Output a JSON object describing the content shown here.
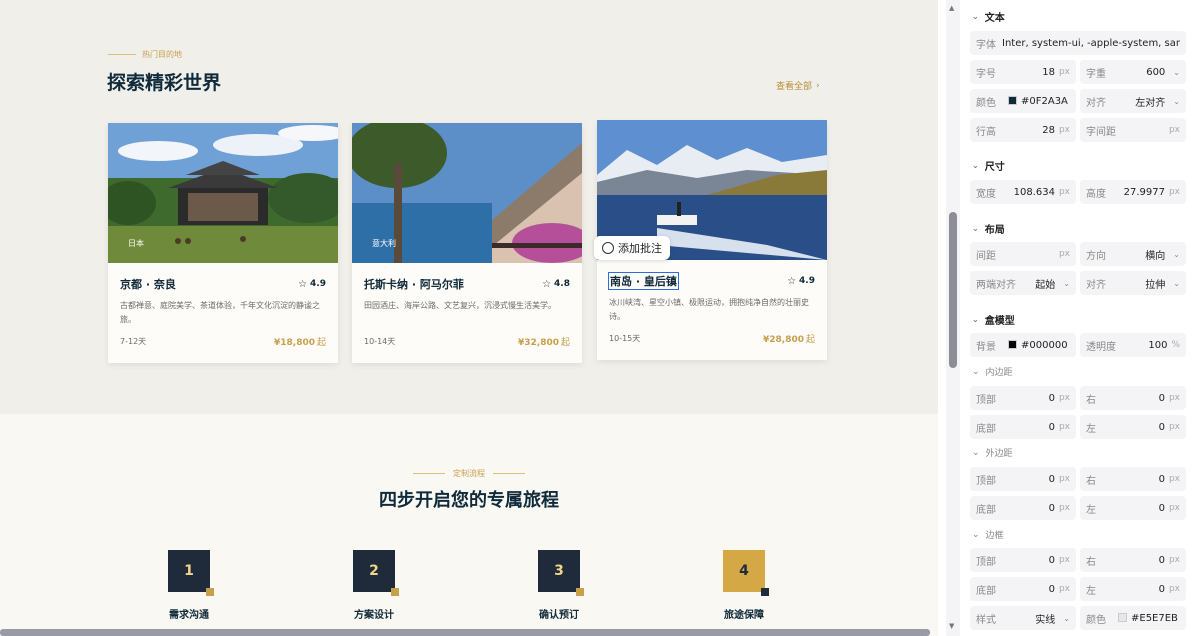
{
  "explore": {
    "eyebrow": "热门目的地",
    "heading": "探索精彩世界",
    "view_all": "查看全部",
    "view_all_arrow": "›",
    "cards": [
      {
        "tag": "日本",
        "title": "京都 · 奈良",
        "rating": "4.9",
        "desc": "古都禅意、庭院美学、茶道体验，千年文化沉淀的静谧之旅。",
        "days": "7-12天",
        "price": "¥18,800",
        "price_suffix": "起"
      },
      {
        "tag": "意大利",
        "title": "托斯卡纳 · 阿马尔菲",
        "rating": "4.8",
        "desc": "田园酒庄、海岸公路、文艺复兴，沉浸式慢生活美学。",
        "days": "10-14天",
        "price": "¥32,800",
        "price_suffix": "起"
      },
      {
        "tag": "",
        "title": "南岛 · 皇后镇",
        "rating": "4.9",
        "desc": "冰川峡湾、星空小镇、极限运动，拥抱纯净自然的壮丽史诗。",
        "days": "10-15天",
        "price": "¥28,800",
        "price_suffix": "起"
      }
    ]
  },
  "annotate_label": "添加批注",
  "steps": {
    "eyebrow": "定制流程",
    "heading": "四步开启您的专属旅程",
    "items": [
      {
        "num": "1",
        "label": "需求沟通"
      },
      {
        "num": "2",
        "label": "方案设计"
      },
      {
        "num": "3",
        "label": "确认预订"
      },
      {
        "num": "4",
        "label": "旅途保障"
      }
    ]
  },
  "panel": {
    "text_section": "文本",
    "font_label": "字体",
    "font_value": "Inter, system-ui, -apple-system, san",
    "size_label": "字号",
    "size_value": "18",
    "px": "px",
    "weight_label": "字重",
    "weight_value": "600",
    "color_label": "颜色",
    "color_value": "#0F2A3A",
    "align_label": "对齐",
    "align_value": "左对齐",
    "lineheight_label": "行高",
    "lineheight_value": "28",
    "letterspacing_label": "字间距",
    "dim_section": "尺寸",
    "width_label": "宽度",
    "width_value": "108.634",
    "height_label": "高度",
    "height_value": "27.9977",
    "layout_section": "布局",
    "gap_label": "间距",
    "direction_label": "方向",
    "direction_value": "横向",
    "justify_label": "两端对齐",
    "justify_value": "起始",
    "align2_label": "对齐",
    "align2_value": "拉伸",
    "box_section": "盒模型",
    "bg_label": "背景",
    "bg_value": "#000000",
    "opacity_label": "透明度",
    "opacity_value": "100",
    "percent": "%",
    "padding_sub": "内边距",
    "margin_sub": "外边距",
    "border_sub": "边框",
    "top_label": "顶部",
    "right_label": "右",
    "bottom_label": "底部",
    "left_label": "左",
    "zero": "0",
    "style_label": "样式",
    "style_value": "实线",
    "bcolor_label": "颜色",
    "bcolor_value": "#E5E7EB"
  },
  "colors": {
    "accent": "#C7A04C",
    "navy": "#1F2A3A",
    "selection": "#2D6CDF"
  }
}
